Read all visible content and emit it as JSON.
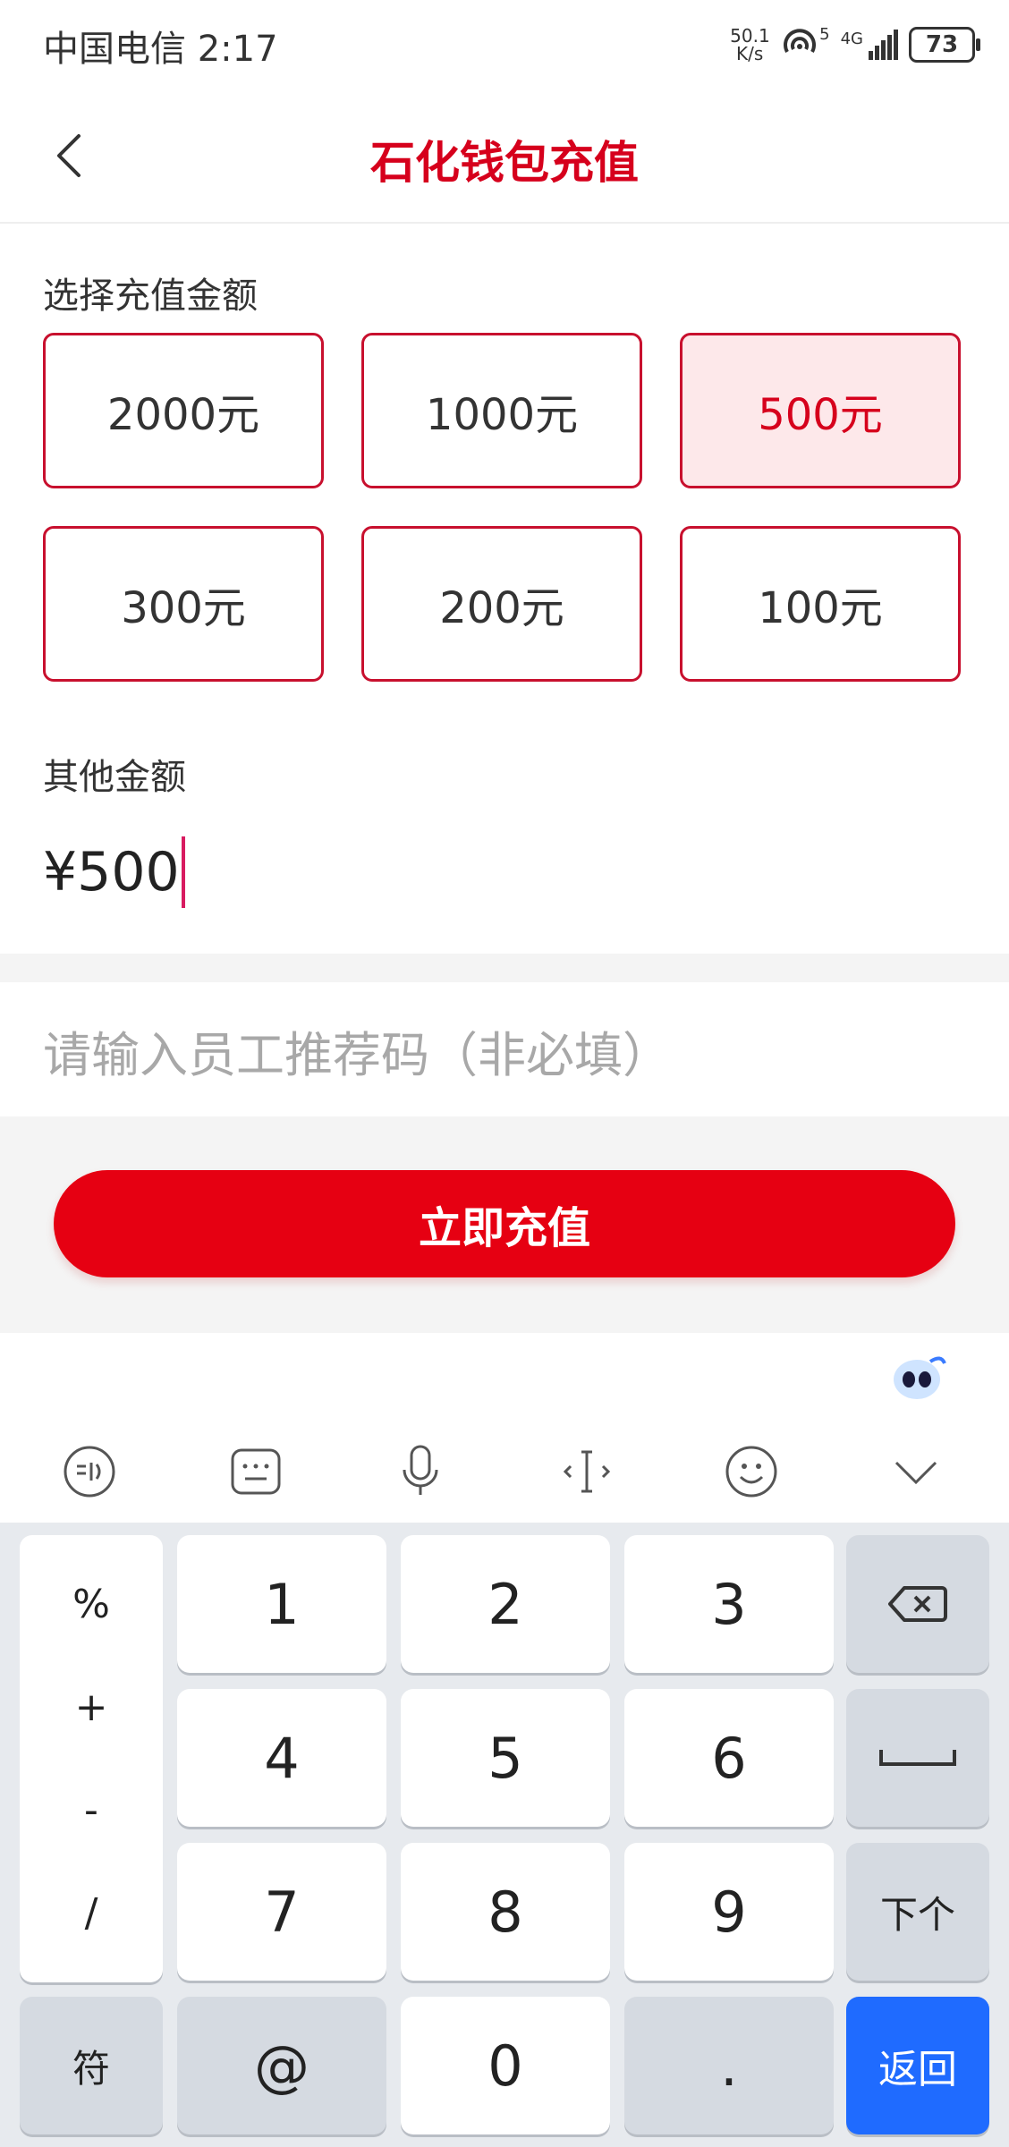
{
  "status_bar": {
    "carrier_time": "中国电信 2:17",
    "net_speed_value": "50.1",
    "net_speed_unit": "K/s",
    "hotspot_sup": "5",
    "network": "4G",
    "battery": "73"
  },
  "header": {
    "title": "石化钱包充值"
  },
  "amount_section": {
    "label": "选择充值金额",
    "options": [
      {
        "label": "2000元",
        "selected": false
      },
      {
        "label": "1000元",
        "selected": false
      },
      {
        "label": "500元",
        "selected": true
      },
      {
        "label": "300元",
        "selected": false
      },
      {
        "label": "200元",
        "selected": false
      },
      {
        "label": "100元",
        "selected": false
      }
    ]
  },
  "other_amount": {
    "label": "其他金额",
    "value": "¥500"
  },
  "referral": {
    "placeholder": "请输入员工推荐码（非必填）"
  },
  "submit": {
    "label": "立即充值"
  },
  "keyboard": {
    "symbols": [
      "%",
      "+",
      "-",
      "/"
    ],
    "digits": [
      "1",
      "2",
      "3",
      "4",
      "5",
      "6",
      "7",
      "8",
      "9",
      "0"
    ],
    "next_label": "下个",
    "symbols_key": "符",
    "at_key": "@",
    "dot_key": ".",
    "return_label": "返回"
  },
  "colors": {
    "brand_red": "#e60012",
    "title_red": "#d6001c",
    "selected_bg": "#fde8ea",
    "return_blue": "#1f6bff"
  }
}
